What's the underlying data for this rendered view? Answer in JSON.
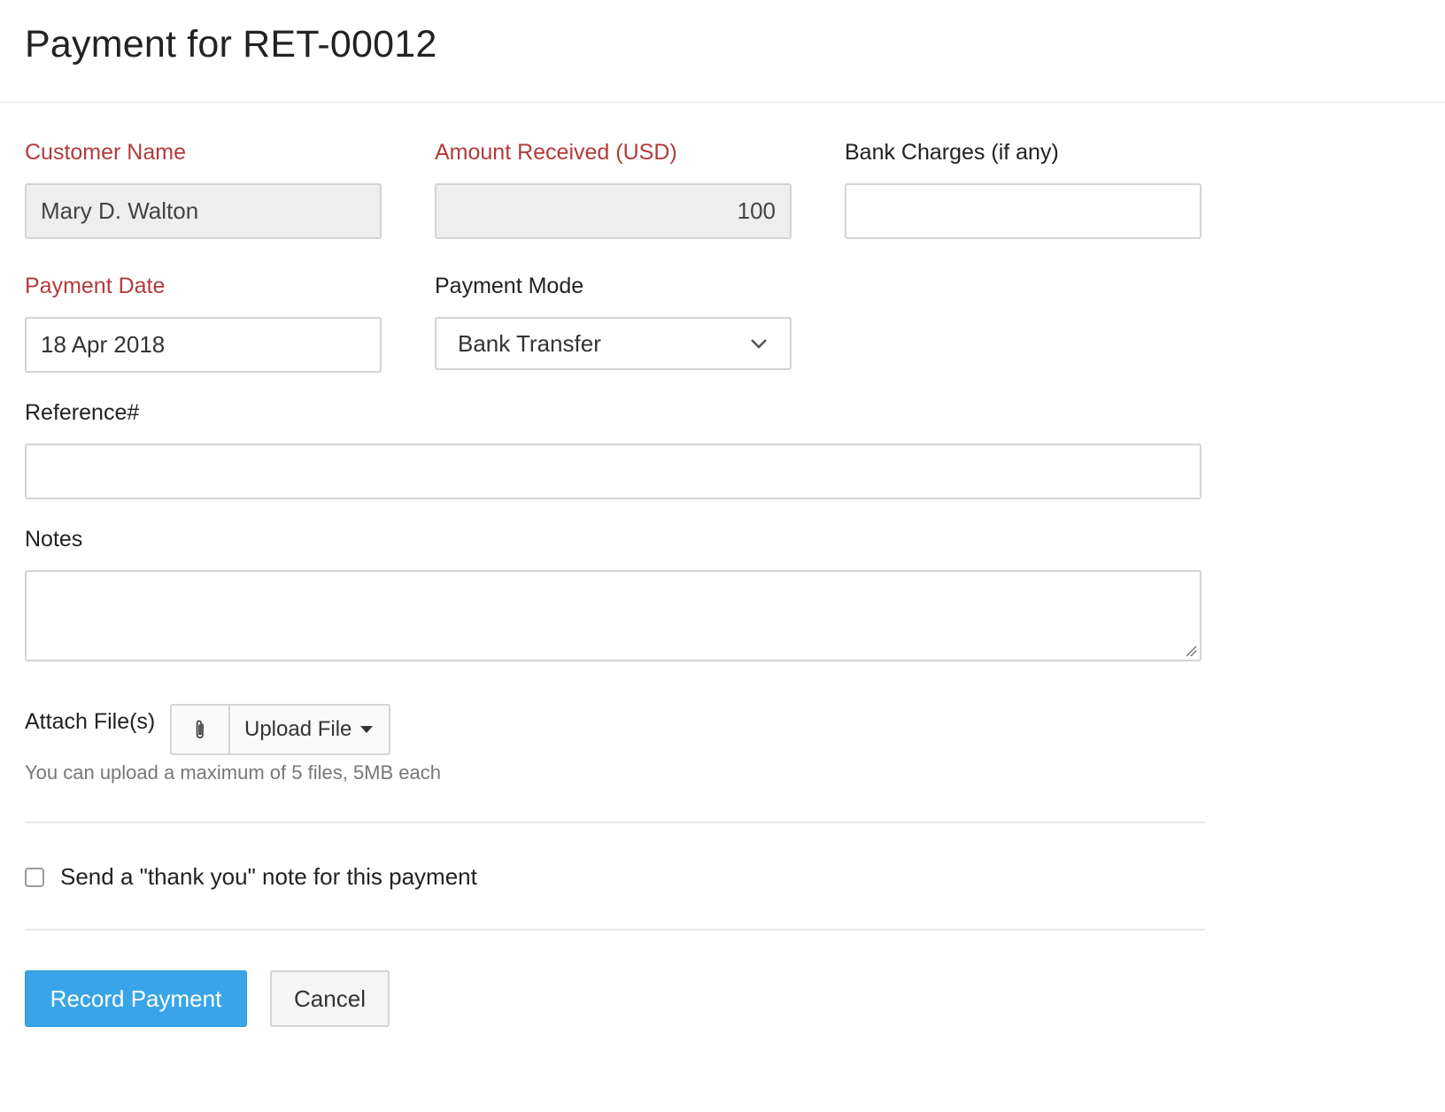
{
  "header": {
    "title": "Payment for RET-00012"
  },
  "form": {
    "customer_name": {
      "label": "Customer Name",
      "value": "Mary D. Walton"
    },
    "amount_received": {
      "label": "Amount Received (USD)",
      "value": "100"
    },
    "bank_charges": {
      "label": "Bank Charges (if any)",
      "value": ""
    },
    "payment_date": {
      "label": "Payment Date",
      "value": "18 Apr 2018"
    },
    "payment_mode": {
      "label": "Payment Mode",
      "selected": "Bank Transfer"
    },
    "reference": {
      "label": "Reference#",
      "value": ""
    },
    "notes": {
      "label": "Notes",
      "value": ""
    },
    "attach": {
      "label": "Attach File(s)",
      "upload_label": "Upload File",
      "help_text": "You can upload a maximum of 5 files, 5MB each"
    },
    "thank_you": {
      "label": "Send a \"thank you\" note for this payment",
      "checked": false
    }
  },
  "actions": {
    "record_label": "Record Payment",
    "cancel_label": "Cancel"
  },
  "colors": {
    "required_label": "#b23b3b",
    "primary_button": "#3aa4e8"
  },
  "icons": {
    "attach": "paperclip-icon",
    "select_arrow": "chevron-down-icon",
    "upload_arrow": "caret-down-icon"
  }
}
